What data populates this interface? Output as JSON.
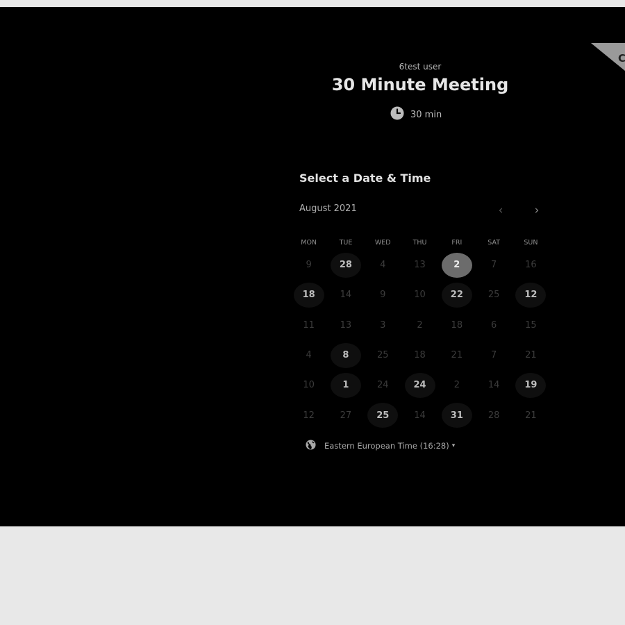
{
  "event": {
    "organizer": "6test user",
    "title": "30 Minute Meeting",
    "duration": "30 min"
  },
  "icons": {
    "clock": "clock-icon",
    "globe": "globe-icon",
    "prev": "chevron-left-icon",
    "next": "chevron-right-icon",
    "caret": "caret-down-icon"
  },
  "colors": {
    "background": "#000000",
    "outer": "#e8e8e8",
    "selected_day": "#6c6c6c",
    "available_day": "#0f0f0f"
  },
  "calendar": {
    "section_title": "Select a Date & Time",
    "month": "August 2021",
    "prev_symbol": "‹",
    "next_symbol": "›",
    "weekdays": [
      "MON",
      "TUE",
      "WED",
      "THU",
      "FRI",
      "SAT",
      "SUN"
    ],
    "days": [
      {
        "label": "9",
        "state": "disabled"
      },
      {
        "label": "28",
        "state": "available"
      },
      {
        "label": "4",
        "state": "disabled"
      },
      {
        "label": "13",
        "state": "disabled"
      },
      {
        "label": "2",
        "state": "selected"
      },
      {
        "label": "7",
        "state": "disabled"
      },
      {
        "label": "16",
        "state": "disabled"
      },
      {
        "label": "18",
        "state": "available"
      },
      {
        "label": "14",
        "state": "disabled"
      },
      {
        "label": "9",
        "state": "disabled"
      },
      {
        "label": "10",
        "state": "disabled"
      },
      {
        "label": "22",
        "state": "available"
      },
      {
        "label": "25",
        "state": "disabled"
      },
      {
        "label": "12",
        "state": "available"
      },
      {
        "label": "11",
        "state": "disabled"
      },
      {
        "label": "13",
        "state": "disabled"
      },
      {
        "label": "3",
        "state": "disabled"
      },
      {
        "label": "2",
        "state": "disabled"
      },
      {
        "label": "18",
        "state": "disabled"
      },
      {
        "label": "6",
        "state": "disabled"
      },
      {
        "label": "15",
        "state": "disabled"
      },
      {
        "label": "4",
        "state": "disabled"
      },
      {
        "label": "8",
        "state": "available"
      },
      {
        "label": "25",
        "state": "disabled"
      },
      {
        "label": "18",
        "state": "disabled"
      },
      {
        "label": "21",
        "state": "disabled"
      },
      {
        "label": "7",
        "state": "disabled"
      },
      {
        "label": "21",
        "state": "disabled"
      },
      {
        "label": "10",
        "state": "disabled"
      },
      {
        "label": "1",
        "state": "available"
      },
      {
        "label": "24",
        "state": "disabled"
      },
      {
        "label": "24",
        "state": "available"
      },
      {
        "label": "2",
        "state": "disabled"
      },
      {
        "label": "14",
        "state": "disabled"
      },
      {
        "label": "19",
        "state": "available"
      },
      {
        "label": "12",
        "state": "disabled"
      },
      {
        "label": "27",
        "state": "disabled"
      },
      {
        "label": "25",
        "state": "available"
      },
      {
        "label": "14",
        "state": "disabled"
      },
      {
        "label": "31",
        "state": "available"
      },
      {
        "label": "28",
        "state": "disabled"
      },
      {
        "label": "21",
        "state": "disabled"
      }
    ]
  },
  "timezone": {
    "label": "Eastern European Time (16:28)",
    "caret": "▾"
  },
  "ribbon": {
    "text": "C"
  }
}
